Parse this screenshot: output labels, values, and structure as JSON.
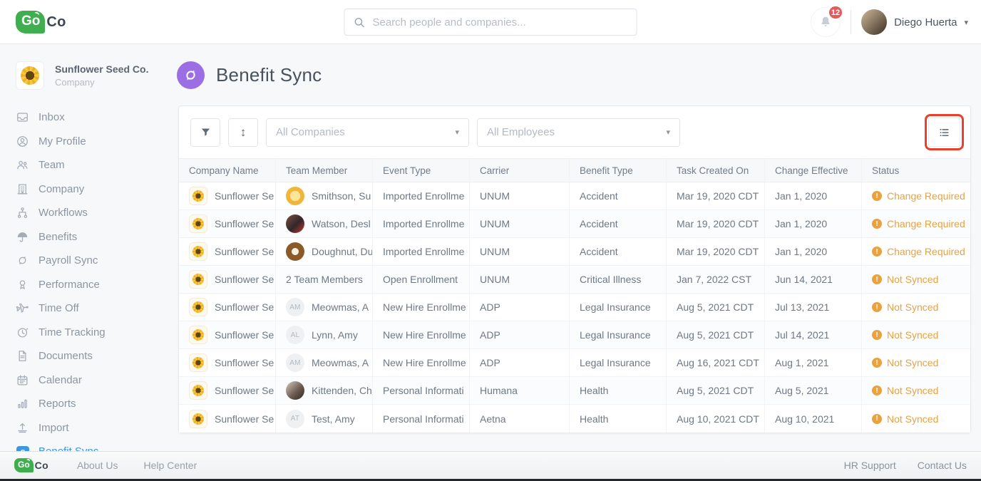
{
  "header": {
    "brand": {
      "go": "Go",
      "co": "Co"
    },
    "search_placeholder": "Search people and companies...",
    "notification_count": "12",
    "user_name": "Diego Huerta"
  },
  "sidebar": {
    "company_name": "Sunflower Seed Co.",
    "company_type": "Company",
    "items": [
      {
        "label": "Inbox",
        "icon": "inbox"
      },
      {
        "label": "My Profile",
        "icon": "profile"
      },
      {
        "label": "Team",
        "icon": "team"
      },
      {
        "label": "Company",
        "icon": "company"
      },
      {
        "label": "Workflows",
        "icon": "workflows"
      },
      {
        "label": "Benefits",
        "icon": "benefits"
      },
      {
        "label": "Payroll Sync",
        "icon": "payroll-sync"
      },
      {
        "label": "Performance",
        "icon": "performance"
      },
      {
        "label": "Time Off",
        "icon": "time-off"
      },
      {
        "label": "Time Tracking",
        "icon": "time-tracking"
      },
      {
        "label": "Documents",
        "icon": "documents"
      },
      {
        "label": "Calendar",
        "icon": "calendar"
      },
      {
        "label": "Reports",
        "icon": "reports"
      },
      {
        "label": "Import",
        "icon": "import"
      },
      {
        "label": "Benefit Sync",
        "icon": "benefit-sync",
        "active": true
      }
    ]
  },
  "page": {
    "title": "Benefit Sync"
  },
  "toolbar": {
    "company_filter": "All Companies",
    "employee_filter": "All Employees"
  },
  "table": {
    "columns": [
      "Company Name",
      "Team Member",
      "Event Type",
      "Carrier",
      "Benefit Type",
      "Task Created On",
      "Change Effective",
      "Status"
    ],
    "rows": [
      {
        "company": "Sunflower Se",
        "member": "Smithson, Su",
        "avatar": {
          "kind": "sun"
        },
        "event": "Imported Enrollme",
        "carrier": "UNUM",
        "benefit": "Accident",
        "created": "Mar 19, 2020 CDT",
        "effective": "Jan 1, 2020",
        "status": "Change Required"
      },
      {
        "company": "Sunflower Se",
        "member": "Watson, Desl",
        "avatar": {
          "kind": "photo-man"
        },
        "event": "Imported Enrollme",
        "carrier": "UNUM",
        "benefit": "Accident",
        "created": "Mar 19, 2020 CDT",
        "effective": "Jan 1, 2020",
        "status": "Change Required"
      },
      {
        "company": "Sunflower Se",
        "member": "Doughnut, Du",
        "avatar": {
          "kind": "donut"
        },
        "event": "Imported Enrollme",
        "carrier": "UNUM",
        "benefit": "Accident",
        "created": "Mar 19, 2020 CDT",
        "effective": "Jan 1, 2020",
        "status": "Change Required"
      },
      {
        "company": "Sunflower Se",
        "member": "2 Team Members",
        "avatar": null,
        "event": "Open Enrollment",
        "carrier": "UNUM",
        "benefit": "Critical Illness",
        "created": "Jan 7, 2022 CST",
        "effective": "Jun 14, 2021",
        "status": "Not Synced"
      },
      {
        "company": "Sunflower Se",
        "member": "Meowmas, A",
        "avatar": {
          "kind": "initials",
          "text": "AM"
        },
        "event": "New Hire Enrollme",
        "carrier": "ADP",
        "benefit": "Legal Insurance",
        "created": "Aug 5, 2021 CDT",
        "effective": "Jul 13, 2021",
        "status": "Not Synced"
      },
      {
        "company": "Sunflower Se",
        "member": "Lynn, Amy",
        "avatar": {
          "kind": "initials",
          "text": "AL"
        },
        "event": "New Hire Enrollme",
        "carrier": "ADP",
        "benefit": "Legal Insurance",
        "created": "Aug 5, 2021 CDT",
        "effective": "Jul 14, 2021",
        "status": "Not Synced"
      },
      {
        "company": "Sunflower Se",
        "member": "Meowmas, A",
        "avatar": {
          "kind": "initials",
          "text": "AM"
        },
        "event": "New Hire Enrollme",
        "carrier": "ADP",
        "benefit": "Legal Insurance",
        "created": "Aug 16, 2021 CDT",
        "effective": "Aug 1, 2021",
        "status": "Not Synced"
      },
      {
        "company": "Sunflower Se",
        "member": "Kittenden, Ch",
        "avatar": {
          "kind": "photo-cat"
        },
        "event": "Personal Informati",
        "carrier": "Humana",
        "benefit": "Health",
        "created": "Aug 5, 2021 CDT",
        "effective": "Aug 5, 2021",
        "status": "Not Synced"
      },
      {
        "company": "Sunflower Se",
        "member": "Test, Amy",
        "avatar": {
          "kind": "initials",
          "text": "AT"
        },
        "event": "Personal Informati",
        "carrier": "Aetna",
        "benefit": "Health",
        "created": "Aug 10, 2021 CDT",
        "effective": "Aug 10, 2021",
        "status": "Not Synced"
      }
    ]
  },
  "footer": {
    "links_left": [
      "About Us",
      "Help Center"
    ],
    "links_right": [
      "HR Support",
      "Contact Us"
    ]
  },
  "colors": {
    "brand_green": "#3eae4f",
    "accent_purple": "#9b6fe3",
    "active_blue": "#3f96e4",
    "status_orange": "#eaa23e",
    "highlight_red": "#e8402a"
  }
}
